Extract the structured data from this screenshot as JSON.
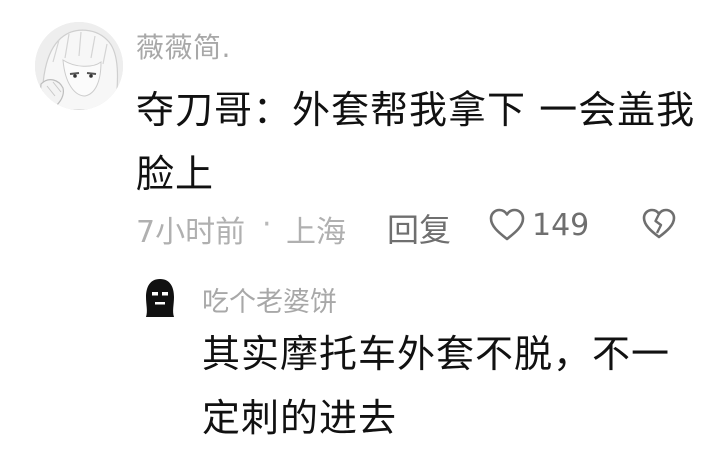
{
  "main_comment": {
    "username": "薇薇简.",
    "text": "夺刀哥：外套帮我拿下 一会盖我脸上",
    "time": "7小时前",
    "separator": "·",
    "location": "上海",
    "reply_label": "回复",
    "like_count": "149"
  },
  "reply_comment": {
    "username": "吃个老婆饼",
    "text": "其实摩托车外套不脱，不一定刺的进去"
  },
  "colors": {
    "text": "#111111",
    "muted": "#a8a8a8",
    "action": "#6f6f6f"
  }
}
